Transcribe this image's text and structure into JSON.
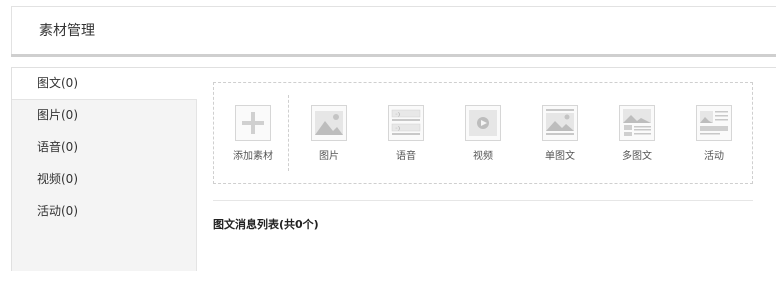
{
  "header": {
    "title": "素材管理"
  },
  "sidebar": {
    "items": [
      {
        "label": "图文(0)",
        "active": true
      },
      {
        "label": "图片(0)",
        "active": false
      },
      {
        "label": "语音(0)",
        "active": false
      },
      {
        "label": "视频(0)",
        "active": false
      },
      {
        "label": "活动(0)",
        "active": false
      }
    ]
  },
  "materials": {
    "add": {
      "label": "添加素材",
      "icon": "plus-icon"
    },
    "items": [
      {
        "label": "图片",
        "icon": "image-icon"
      },
      {
        "label": "语音",
        "icon": "voice-icon"
      },
      {
        "label": "视频",
        "icon": "video-icon"
      },
      {
        "label": "单图文",
        "icon": "single-article-icon"
      },
      {
        "label": "多图文",
        "icon": "multi-article-icon"
      },
      {
        "label": "活动",
        "icon": "activity-icon"
      }
    ]
  },
  "list": {
    "title": "图文消息列表(共0个)"
  },
  "colors": {
    "border": "#e0e0e0",
    "sidebar_bg": "#f4f4f4",
    "icon_gray": "#c8c8c8"
  }
}
